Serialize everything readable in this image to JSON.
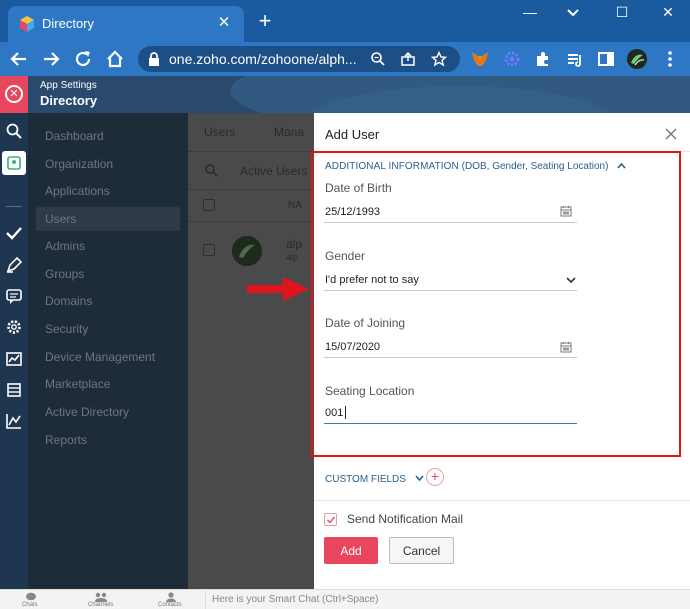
{
  "browser": {
    "tab_title": "Directory",
    "url": "one.zoho.com/zohoone/alph...",
    "close_glyph": "✕",
    "newtab_glyph": "+",
    "minimize_glyph": "—",
    "maximize_glyph": "☐",
    "window_close_glyph": "✕"
  },
  "app": {
    "subtitle": "App Settings",
    "title": "Directory",
    "rail_close_glyph": "✕"
  },
  "sidebar": {
    "items": [
      {
        "label": "Dashboard"
      },
      {
        "label": "Organization"
      },
      {
        "label": "Applications"
      },
      {
        "label": "Users"
      },
      {
        "label": "Admins"
      },
      {
        "label": "Groups"
      },
      {
        "label": "Domains"
      },
      {
        "label": "Security"
      },
      {
        "label": "Device Management"
      },
      {
        "label": "Marketplace"
      },
      {
        "label": "Active Directory"
      },
      {
        "label": "Reports"
      }
    ],
    "active_index": 3
  },
  "content": {
    "tab_users": "Users",
    "tab_manage": "Mana",
    "filter": "Active Users",
    "col_name": "NA",
    "row_name": "alp",
    "row_sub": "alp"
  },
  "panel": {
    "title": "Add User",
    "section_head": "ADDITIONAL INFORMATION",
    "section_sub": " (DOB, Gender, Seating Location)",
    "dob_label": "Date of Birth",
    "dob_value": "25/12/1993",
    "gender_label": "Gender",
    "gender_value": "I'd prefer not to say",
    "doj_label": "Date of Joining",
    "doj_value": "15/07/2020",
    "seat_label": "Seating Location",
    "seat_value": "001",
    "custom_fields": "CUSTOM FIELDS",
    "plus_glyph": "+",
    "notify_label": "Send Notification Mail",
    "notify_checked": true,
    "add_label": "Add",
    "cancel_label": "Cancel"
  },
  "bottombar": {
    "chats": "Chats",
    "channels": "Channels",
    "contacts": "Contacts",
    "smart_chat": "Here is your Smart Chat (Ctrl+Space)"
  },
  "colors": {
    "accent": "#e8465c",
    "header": "#294a6d",
    "browser": "#2e77c4",
    "highlight": "#e0141e",
    "link": "#2d5f8b"
  }
}
